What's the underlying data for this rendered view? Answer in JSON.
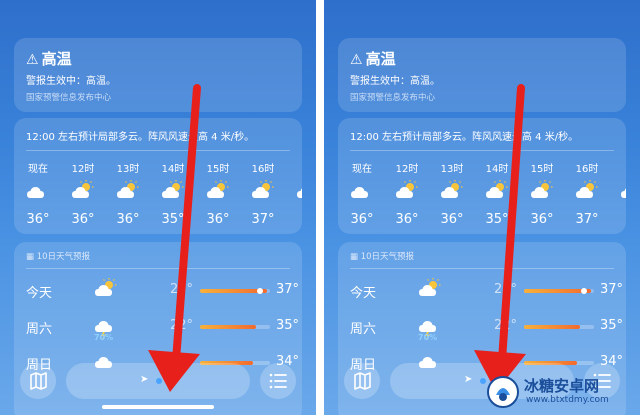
{
  "alert": {
    "icon": "warning-triangle-icon",
    "title": "高温",
    "line1": "警报生效中：高温。",
    "source": "国家预警信息发布中心"
  },
  "hourly_summary": "12:00 左右预计局部多云。阵风风速最高 4 米/秒。",
  "hourly": [
    {
      "time": "现在",
      "icon": "cloud-icon",
      "temp": "36°"
    },
    {
      "time": "12时",
      "icon": "sun-cloud-icon",
      "temp": "36°"
    },
    {
      "time": "13时",
      "icon": "sun-cloud-icon",
      "temp": "36°"
    },
    {
      "time": "14时",
      "icon": "sun-cloud-icon",
      "temp": "35°"
    },
    {
      "time": "15时",
      "icon": "sun-cloud-icon",
      "temp": "36°"
    },
    {
      "time": "16时",
      "icon": "sun-cloud-icon",
      "temp": "37°"
    },
    {
      "time": "1",
      "icon": "sun-cloud-icon",
      "temp": "3"
    }
  ],
  "daily_header": "10日天气预报",
  "daily": [
    {
      "day": "今天",
      "icon": "sun-cloud-icon",
      "precip": "",
      "low": "25°",
      "high": "37°",
      "bar_start": 0.0,
      "bar_end": 0.95,
      "current": 0.85
    },
    {
      "day": "周六",
      "icon": "thunder-rain-icon",
      "precip": "70%",
      "low": "22°",
      "high": "35°",
      "bar_start": 0.0,
      "bar_end": 0.8,
      "current": null
    },
    {
      "day": "周日",
      "icon": "cloud-icon",
      "precip": "",
      "low": "",
      "high": "34°",
      "bar_start": 0.0,
      "bar_end": 0.75,
      "current": null
    }
  ],
  "tabbar": {
    "map_icon": "map-icon",
    "list_icon": "list-icon",
    "location_icon": "location-arrow-icon"
  },
  "watermark": {
    "name": "冰糖安卓网",
    "url": "www.btxtdmy.com"
  },
  "colors": {
    "arrow": "#e8201c",
    "accent_dot": "#4aa3ff"
  }
}
